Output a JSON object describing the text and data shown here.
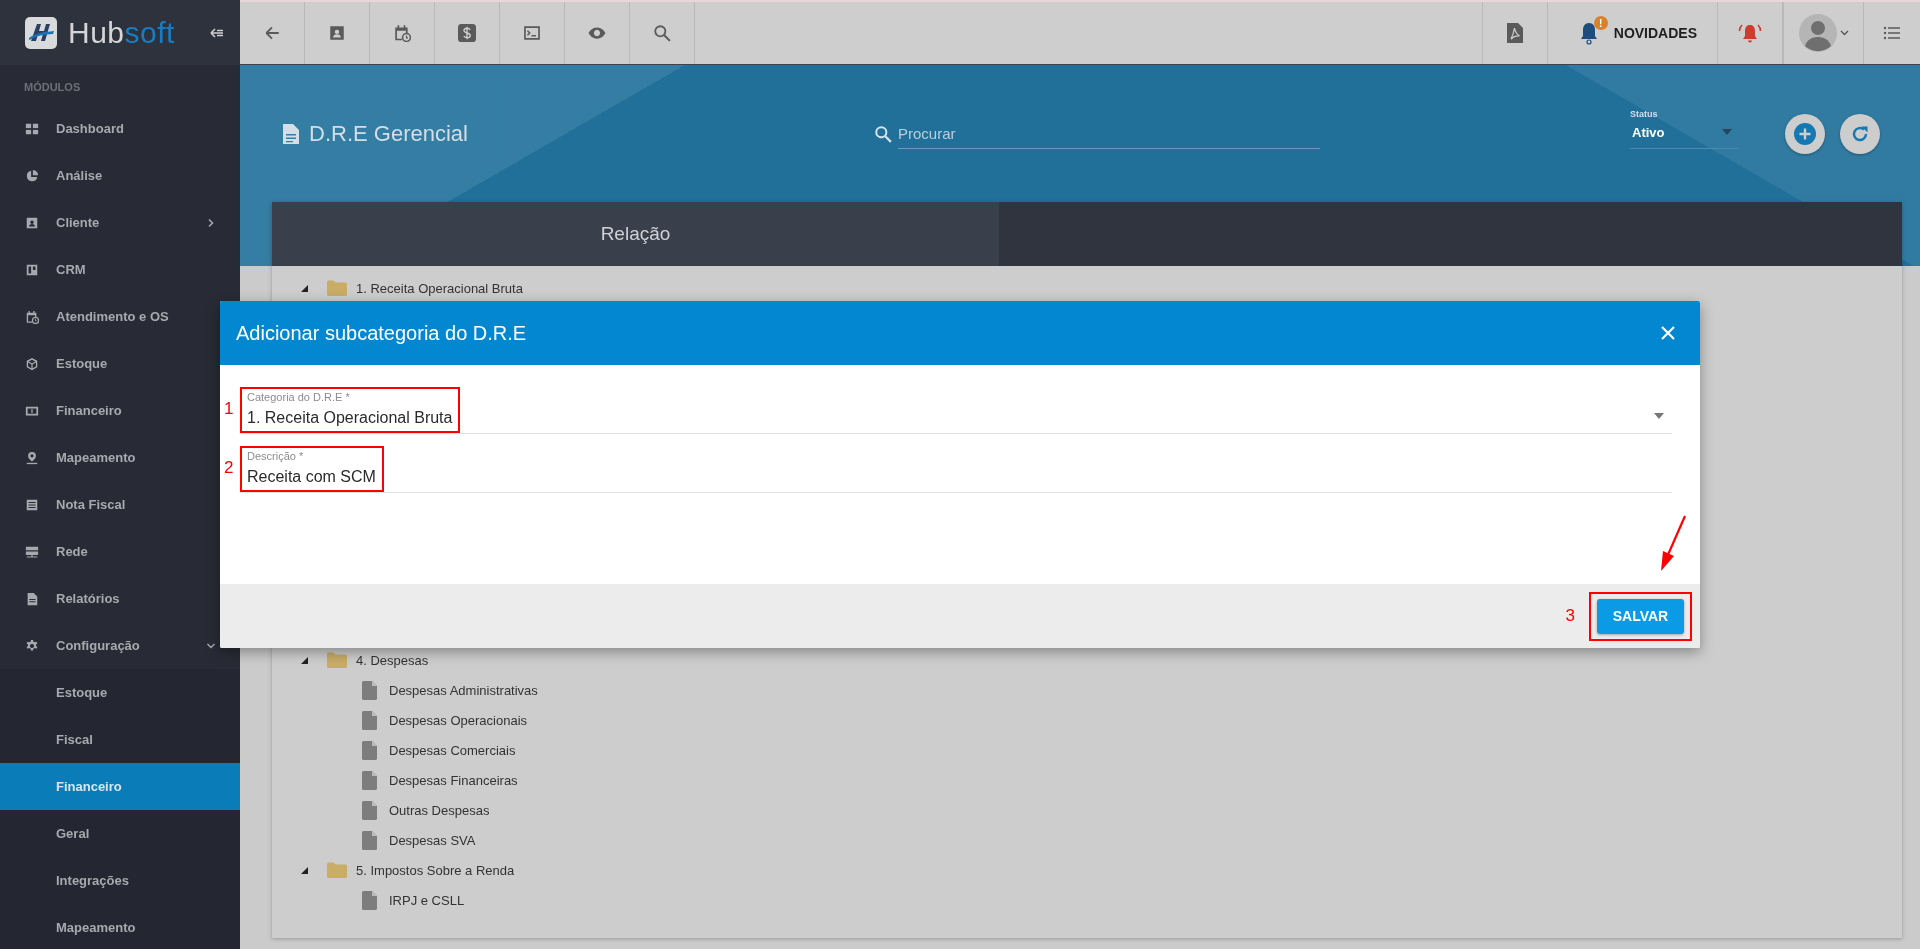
{
  "brand": {
    "name_part_1": "Hub",
    "name_part_2": "soft"
  },
  "topbar": {
    "news_label": "NOVIDADES",
    "news_badge": "!"
  },
  "sidebar": {
    "section_label": "MÓDULOS",
    "items": [
      {
        "kind": "link",
        "label": "Dashboard",
        "selected": false
      },
      {
        "kind": "link",
        "label": "Análise",
        "selected": false
      },
      {
        "kind": "group",
        "label": "Cliente",
        "expanded": false,
        "selected": false
      },
      {
        "kind": "link",
        "label": "CRM",
        "selected": false
      },
      {
        "kind": "link",
        "label": "Atendimento e OS",
        "selected": false
      },
      {
        "kind": "link",
        "label": "Estoque",
        "selected": false
      },
      {
        "kind": "link",
        "label": "Financeiro",
        "selected": false
      },
      {
        "kind": "link",
        "label": "Mapeamento",
        "selected": false
      },
      {
        "kind": "link",
        "label": "Nota Fiscal",
        "selected": false
      },
      {
        "kind": "link",
        "label": "Rede",
        "selected": false
      },
      {
        "kind": "link",
        "label": "Relatórios",
        "selected": false
      },
      {
        "kind": "group",
        "label": "Configuração",
        "expanded": true,
        "selected": false,
        "children": [
          {
            "label": "Estoque",
            "selected": false
          },
          {
            "label": "Fiscal",
            "selected": false
          },
          {
            "label": "Financeiro",
            "selected": true
          },
          {
            "label": "Geral",
            "selected": false
          },
          {
            "label": "Integrações",
            "selected": false
          },
          {
            "label": "Mapeamento",
            "selected": false
          }
        ]
      }
    ]
  },
  "page": {
    "title": "D.R.E Gerencial",
    "search": {
      "placeholder": "Procurar"
    },
    "status": {
      "label": "Status",
      "value": "Ativo"
    }
  },
  "tabs": [
    {
      "label": "Relação",
      "selected": true
    }
  ],
  "tree": [
    {
      "label": "1. Receita Operacional Bruta",
      "expanded": true
    },
    {
      "label": "4. Despesas",
      "expanded": true,
      "children": [
        {
          "label": "Despesas Administrativas"
        },
        {
          "label": "Despesas Operacionais"
        },
        {
          "label": "Despesas Comerciais"
        },
        {
          "label": "Despesas Financeiras"
        },
        {
          "label": "Outras Despesas"
        },
        {
          "label": "Despesas SVA"
        }
      ]
    },
    {
      "label": "5. Impostos Sobre a Renda",
      "expanded": true,
      "children": [
        {
          "label": "IRPJ e CSLL"
        }
      ]
    }
  ],
  "dialog": {
    "title": "Adicionar subcategoria do D.R.E",
    "fields": [
      {
        "kind": "select",
        "label": "Categoria do D.R.E *",
        "value": "1. Receita Operacional Bruta",
        "annotation": "1"
      },
      {
        "kind": "text",
        "label": "Descrição *",
        "value": "Receita com SCM",
        "annotation": "2"
      }
    ],
    "buttons": [
      {
        "label": "SALVAR",
        "annotation": "3"
      }
    ]
  }
}
